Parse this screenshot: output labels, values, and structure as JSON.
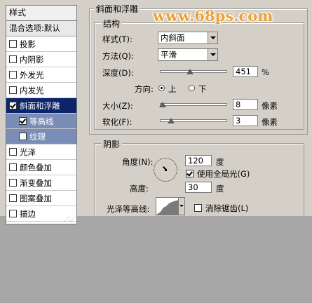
{
  "watermark": "www.68ps.com",
  "sidebar": {
    "title": "样式",
    "blend_default": "混合选项:默认",
    "items": [
      {
        "label": "投影",
        "checked": false
      },
      {
        "label": "内阴影",
        "checked": false
      },
      {
        "label": "外发光",
        "checked": false
      },
      {
        "label": "内发光",
        "checked": false
      },
      {
        "label": "斜面和浮雕",
        "checked": true
      },
      {
        "label": "等高线",
        "checked": true
      },
      {
        "label": "纹理",
        "checked": false
      },
      {
        "label": "光泽",
        "checked": false
      },
      {
        "label": "颜色叠加",
        "checked": false
      },
      {
        "label": "渐变叠加",
        "checked": false
      },
      {
        "label": "图案叠加",
        "checked": false
      },
      {
        "label": "描边",
        "checked": false
      }
    ]
  },
  "bevel": {
    "title": "斜面和浮雕",
    "structure_title": "结构",
    "style_label": "样式(T):",
    "style_value": "内斜面",
    "technique_label": "方法(Q):",
    "technique_value": "平滑",
    "depth_label": "深度(D):",
    "depth_value": "451",
    "depth_unit": "%",
    "depth_fraction": 0.45,
    "direction_label": "方向:",
    "direction_up": "上",
    "direction_down": "下",
    "size_label": "大小(Z):",
    "size_value": "8",
    "size_unit": "像素",
    "size_fraction": 0.03,
    "soften_label": "软化(F):",
    "soften_value": "3",
    "soften_unit": "像素",
    "soften_fraction": 0.16
  },
  "shading": {
    "title": "阴影",
    "angle_label": "角度(N):",
    "angle_value": "120",
    "angle_unit": "度",
    "global_light_label": "使用全局光(G)",
    "altitude_label": "高度:",
    "altitude_value": "30",
    "altitude_unit": "度",
    "gloss_label": "光泽等高线:",
    "antialias_label": "消除锯齿(L)"
  }
}
